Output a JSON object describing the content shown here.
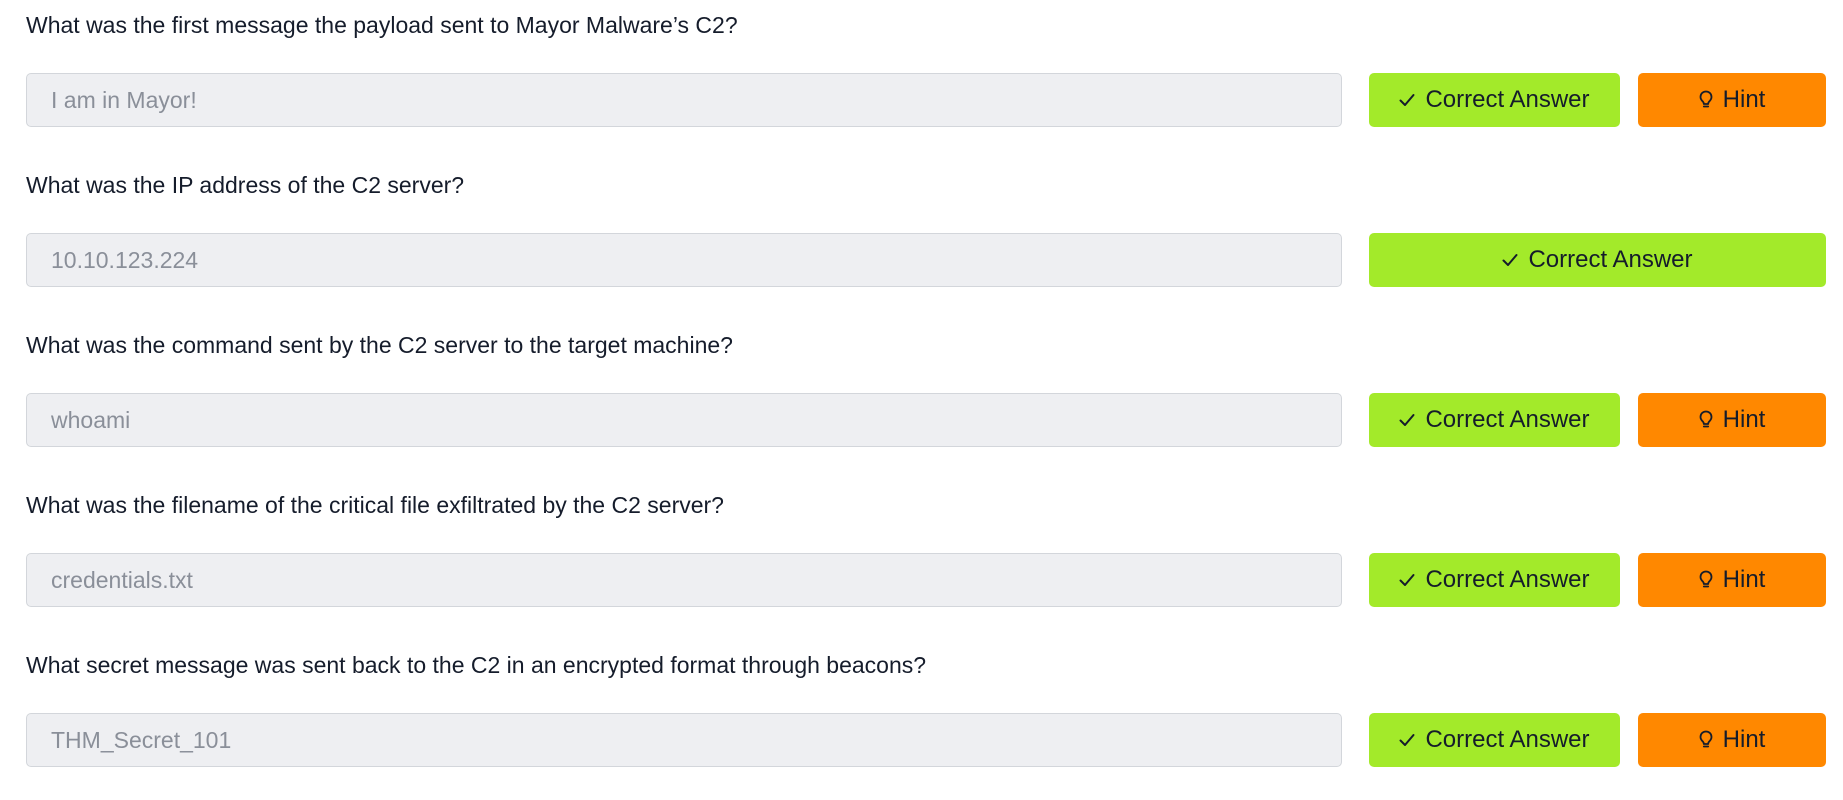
{
  "questions": [
    {
      "question": "What was the first message the payload sent to Mayor Malware’s C2?",
      "answer": "I am in Mayor!",
      "correct_label": "Correct Answer",
      "hint_label": "Hint"
    },
    {
      "question": "What was the IP address of the C2 server?",
      "answer": "10.10.123.224",
      "correct_label": "Correct Answer"
    },
    {
      "question": "What was the command sent by the C2 server to the target machine?",
      "answer": "whoami",
      "correct_label": "Correct Answer",
      "hint_label": "Hint"
    },
    {
      "question": "What was the filename of the critical file exfiltrated by the C2 server?",
      "answer": "credentials.txt",
      "correct_label": "Correct Answer",
      "hint_label": "Hint"
    },
    {
      "question": "What secret message was sent back to the C2 in an encrypted format through beacons?",
      "answer": "THM_Secret_101",
      "correct_label": "Correct Answer",
      "hint_label": "Hint"
    }
  ],
  "icons": {
    "correct": "checkmark-icon",
    "hint": "lightbulb-icon"
  },
  "colors": {
    "correct_button": "#a3ea2a",
    "hint_button": "#ff8800",
    "field_background": "#eeeff2",
    "answer_text": "#8a8f99",
    "question_text": "#151c2b"
  }
}
